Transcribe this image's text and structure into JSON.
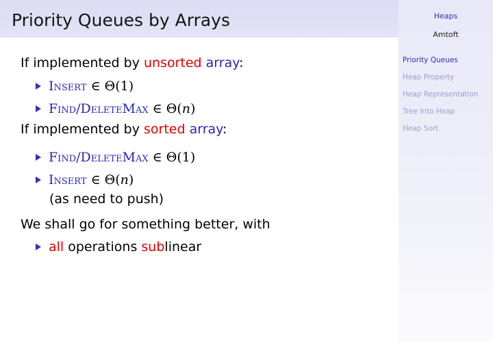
{
  "slide": {
    "title": "Priority Queues by Arrays"
  },
  "sidebar": {
    "title": "Heaps",
    "author": "Amtoft",
    "nav": [
      {
        "label": "Priority Queues",
        "active": true
      },
      {
        "label": "Heap Property",
        "active": false
      },
      {
        "label": "Heap Representation",
        "active": false
      },
      {
        "label": "Tree Into Heap",
        "active": false
      },
      {
        "label": "Heap Sort",
        "active": false
      }
    ]
  },
  "content": {
    "unsorted_intro": {
      "pre": "If implemented by ",
      "kw": "unsorted",
      "noun": "array",
      "post": ":"
    },
    "unsorted_items": [
      {
        "op": "Insert",
        "rel": "∈ Θ(",
        "arg": "1",
        "close": ")"
      },
      {
        "op": "Find/DeleteMax",
        "rel": "∈ Θ(",
        "arg": "n",
        "close": ")"
      }
    ],
    "sorted_intro": {
      "pre": "If implemented by ",
      "kw": "sorted",
      "noun": "array",
      "post": ":"
    },
    "sorted_items": [
      {
        "op": "Find/DeleteMax",
        "rel": "∈ Θ(",
        "arg": "1",
        "close": ")"
      },
      {
        "op": "Insert",
        "rel": "∈ Θ(",
        "arg": "n",
        "close": ")",
        "note": "(as need to push)"
      }
    ],
    "conclusion": "We shall go for something better, with",
    "final_item": {
      "kw1": "all",
      "mid": " operations ",
      "kw2": "sub",
      "rest": "linear"
    }
  }
}
